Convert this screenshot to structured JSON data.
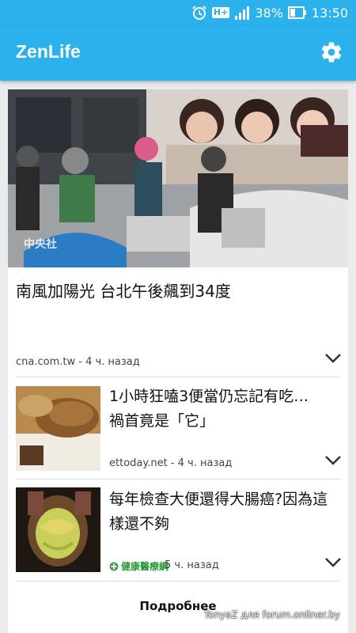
{
  "status": {
    "network": "H+",
    "battery_percent": "38%",
    "time": "13:50"
  },
  "app": {
    "title": "ZenLife",
    "settings_icon": "gear-icon"
  },
  "feed": {
    "hero": {
      "photo_watermark": "中央社",
      "title": "南風加陽光 台北午後飆到34度",
      "source_time": "cna.com.tw - 4 ч. назад"
    },
    "items": [
      {
        "title": "1小時狂嗑3便當仍忘記有吃…　禍首竟是「它」",
        "source_time": "ettoday.net - 4 ч. назад"
      },
      {
        "title": "每年檢查大便還得大腸癌?因為這樣還不夠",
        "source_logo_text": "健康醫療網",
        "time": "5 ч. назад"
      }
    ],
    "more_label": "Подробнее"
  },
  "watermark": "TonyaZ для forum.onliner.by",
  "colors": {
    "accent": "#2bb1eb",
    "card_bg": "#ffffff",
    "page_bg": "#ebebeb"
  }
}
